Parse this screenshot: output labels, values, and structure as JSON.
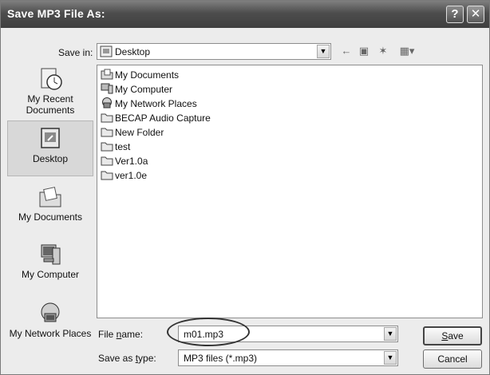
{
  "window": {
    "title": "Save MP3 File As:",
    "help_button": "?",
    "close_button": "✕"
  },
  "save_in": {
    "label": "Save in:",
    "value": "Desktop"
  },
  "toolbar": {
    "back": "←",
    "up": "▣",
    "new_folder": "✶",
    "view_menu": "▦▾"
  },
  "places": [
    {
      "label": "My Recent Documents",
      "icon": "recent-documents-icon"
    },
    {
      "label": "Desktop",
      "icon": "desktop-icon",
      "selected": true
    },
    {
      "label": "My Documents",
      "icon": "my-documents-icon"
    },
    {
      "label": "My Computer",
      "icon": "my-computer-icon"
    },
    {
      "label": "My Network Places",
      "icon": "network-places-icon"
    }
  ],
  "files": [
    {
      "name": "My Documents",
      "icon": "my-documents-icon"
    },
    {
      "name": "My Computer",
      "icon": "my-computer-icon"
    },
    {
      "name": "My Network Places",
      "icon": "network-places-icon"
    },
    {
      "name": "BECAP Audio Capture",
      "icon": "folder-icon"
    },
    {
      "name": "New Folder",
      "icon": "folder-icon"
    },
    {
      "name": "test",
      "icon": "folder-icon"
    },
    {
      "name": "Ver1.0a",
      "icon": "folder-icon"
    },
    {
      "name": "ver1.0e",
      "icon": "folder-icon"
    }
  ],
  "file_name": {
    "label_pre": "File ",
    "label_u": "n",
    "label_post": "ame:",
    "value": "m01.mp3"
  },
  "save_as_type": {
    "label_pre": "Save as ",
    "label_u": "t",
    "label_post": "ype:",
    "value": "MP3 files (*.mp3)"
  },
  "buttons": {
    "save_u": "S",
    "save_rest": "ave",
    "cancel": "Cancel"
  }
}
